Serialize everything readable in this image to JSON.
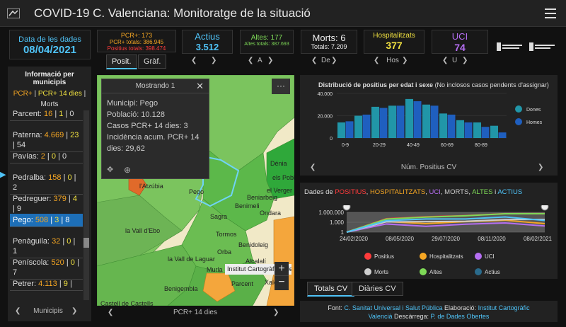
{
  "header": {
    "title": "COVID-19 C. Valenciana: Monitoratge de la situació"
  },
  "date": {
    "label": "Data de les dades",
    "value": "08/04/2021"
  },
  "pcr": {
    "line1": "PCR+: 173",
    "line2": "PCR+ totals: 386.945",
    "line3": "Positius totals: 398.474",
    "tabs": [
      "Posit.",
      "Gràf."
    ]
  },
  "actius": {
    "label": "Actius",
    "value": "3.512"
  },
  "altes": {
    "label": "Altes: 177",
    "sub": "Altes totals: 387.693",
    "nav": "A"
  },
  "morts": {
    "label": "Morts: 6",
    "sub": "Totals: 7.209",
    "nav": "De"
  },
  "hosp": {
    "label": "Hospitalitzats",
    "value": "377",
    "nav": "Hos"
  },
  "uci": {
    "label": "UCI",
    "value": "74",
    "nav": "U"
  },
  "muni_panel": {
    "title": "Informació per municipis",
    "sub1": "PCR+",
    "sub2": "PCR+ 14 dies",
    "sub3": "Morts",
    "rows": [
      {
        "name": "Parcent:",
        "a": "16",
        "b": "1",
        "c": "0"
      },
      {
        "name": "Paterna:",
        "a": "4.669",
        "b": "23",
        "c": "54"
      },
      {
        "name": "Pavías:",
        "a": "2",
        "b": "0",
        "c": "0"
      },
      {
        "name": "Pedralba:",
        "a": "158",
        "b": "0",
        "c": "2"
      },
      {
        "name": "Pedreguer:",
        "a": "379",
        "b": "4",
        "c": "9"
      },
      {
        "name": "Pego:",
        "a": "508",
        "b": "3",
        "c": "8"
      },
      {
        "name": "Penàguila:",
        "a": "32",
        "b": "0",
        "c": "1"
      },
      {
        "name": "Peníscola:",
        "a": "520",
        "b": "0",
        "c": "7"
      },
      {
        "name": "Petrer:",
        "a": "4.113",
        "b": "9",
        "c": ""
      }
    ],
    "bottom_label": "Municipis"
  },
  "popup": {
    "title": "Mostrando 1",
    "lines": [
      "Municipi: Pego",
      "Població: 10.128",
      "Casos PCR+ 14 dies: 3",
      "Incidència acum. PCR+ 14",
      "dies: 29,62"
    ]
  },
  "map": {
    "places": [
      "Dénia",
      "els Poblets",
      "el Verger",
      "Beniarbeig",
      "Benimeli",
      "Sagra",
      "Tormos",
      "Ondara",
      "Benidoleig",
      "Orba",
      "Pego",
      "la Vall d'Ebo",
      "la Vall de Laguar",
      "Murla",
      "Alcalalí",
      "Xaló",
      "Benigembla",
      "Parcent",
      "Castell de Castells",
      "l'Atzúbia"
    ],
    "attribution": "Institut Cartogràfic Vale...",
    "bottom_label": "PCR+ 14 dies"
  },
  "age_chart": {
    "title": "Distribució de positius per edat i sexe",
    "subtitle": "(No inclosos casos pendents d'assignar)",
    "bottom_label": "Núm. Positius CV"
  },
  "trend_chart": {
    "title_prefix": "Dades de",
    "k1": "POSITIUS",
    "k2": "HOSPITALITZATS",
    "k3": "UCI",
    "k4": "MORTS",
    "k5": "ALTES",
    "k6": "ACTIUS",
    "tabs": [
      "Totals CV",
      "Diàries CV"
    ]
  },
  "footer": {
    "line1a": "Font:",
    "line1b": "C. Sanitat Universal i Salut Pública",
    "line1c": "Elaboració:",
    "line1d": "Institut Cartogràfic",
    "line2a": "Valencià",
    "line2b": "Descàrrega:",
    "line2c": "P. de Dades Obertes"
  },
  "colors": {
    "accent": "#4fc3f7",
    "orange": "#f5a623",
    "yellow": "#f0e040",
    "green": "#7ed957",
    "purple": "#b56ef2",
    "red": "#ff3b3b",
    "dones": "#2196a8",
    "homes": "#1f5fbf"
  },
  "chart_data": [
    {
      "type": "bar",
      "title": "Distribució de positius per edat i sexe",
      "categories": [
        "0-9",
        "",
        "20-29",
        "",
        "40-49",
        "",
        "60-69",
        "",
        "80-89",
        ""
      ],
      "yticks": [
        "0",
        "20.000",
        "40.000"
      ],
      "ylim": [
        0,
        40000
      ],
      "series": [
        {
          "name": "Dones",
          "values": [
            14000,
            20000,
            28000,
            29000,
            35000,
            30000,
            22000,
            16000,
            14000,
            11000
          ]
        },
        {
          "name": "Homes",
          "values": [
            15000,
            21000,
            27000,
            29000,
            33000,
            29000,
            21000,
            14000,
            10000,
            5000
          ]
        }
      ],
      "xlabel": "Núm. Positius CV"
    },
    {
      "type": "line",
      "xticks": [
        "24/02/2020",
        "08/05/2020",
        "29/07/2020",
        "08/11/2020",
        "08/02/2021"
      ],
      "yticks": [
        "1",
        "1.000",
        "1.000.000"
      ],
      "yscale": "log",
      "series": [
        {
          "name": "Positius",
          "values": [
            1,
            12000,
            45000,
            100000,
            390000,
            398474
          ]
        },
        {
          "name": "Hospitalitzats",
          "values": [
            1,
            1500,
            400,
            1500,
            4000,
            377
          ]
        },
        {
          "name": "UCI",
          "values": [
            1,
            300,
            60,
            250,
            600,
            74
          ]
        },
        {
          "name": "Morts",
          "values": [
            1,
            1300,
            1500,
            2000,
            6500,
            7209
          ]
        },
        {
          "name": "Altes",
          "values": [
            1,
            9000,
            35000,
            90000,
            380000,
            387693
          ]
        },
        {
          "name": "Actius",
          "values": [
            1,
            3000,
            10000,
            10000,
            40000,
            3512
          ]
        }
      ],
      "legend": [
        "Positius",
        "Hospitalitzats",
        "UCI",
        "Morts",
        "Altes",
        "Actius"
      ]
    }
  ]
}
